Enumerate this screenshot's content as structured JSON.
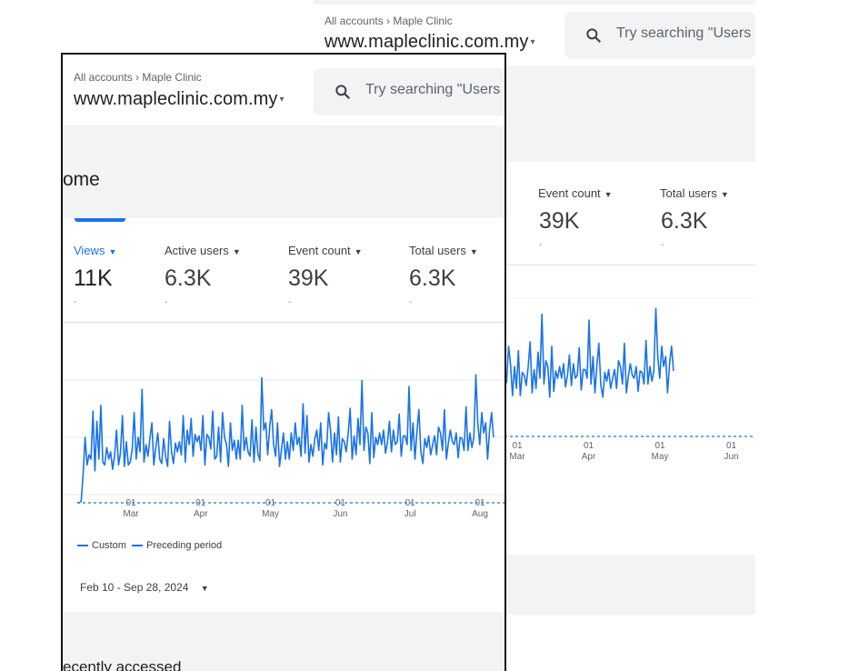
{
  "header": {
    "breadcrumb_root": "All accounts",
    "breadcrumb_sep": "›",
    "breadcrumb_account": "Maple Clinic",
    "property": "www.mapleclinic.com.my",
    "property_caret": "▾",
    "search_placeholder": "Try searching \"Users o"
  },
  "page_title": "ome",
  "metrics": [
    {
      "label": "Views",
      "value": "11K",
      "sub": "-",
      "caret": "▼"
    },
    {
      "label": "Active users",
      "value": "6.3K",
      "sub": "-",
      "caret": "▼"
    },
    {
      "label": "Event count",
      "value": "39K",
      "sub": "-",
      "caret": "▼"
    },
    {
      "label": "Total users",
      "value": "6.3K",
      "sub": "-",
      "caret": "▼"
    }
  ],
  "chart_data": {
    "type": "line",
    "x_ticks": [
      {
        "day": "01",
        "month": "Mar"
      },
      {
        "day": "01",
        "month": "Apr"
      },
      {
        "day": "01",
        "month": "May"
      },
      {
        "day": "01",
        "month": "Jun"
      },
      {
        "day": "01",
        "month": "Jul"
      },
      {
        "day": "01",
        "month": "Aug"
      }
    ],
    "series": [
      {
        "name": "Custom",
        "style": "solid",
        "color": "#1a73e8",
        "values": [
          0,
          0,
          1,
          20,
          45,
          26,
          33,
          30,
          63,
          22,
          56,
          30,
          67,
          28,
          26,
          38,
          30,
          35,
          23,
          32,
          50,
          26,
          34,
          60,
          25,
          42,
          26,
          28,
          37,
          62,
          30,
          45,
          35,
          78,
          28,
          40,
          32,
          44,
          55,
          26,
          38,
          48,
          30,
          27,
          44,
          32,
          25,
          56,
          35,
          27,
          41,
          35,
          42,
          33,
          60,
          28,
          50,
          40,
          58,
          32,
          47,
          42,
          46,
          36,
          60,
          26,
          47,
          45,
          37,
          63,
          30,
          32,
          52,
          28,
          62,
          45,
          40,
          25,
          55,
          36,
          43,
          30,
          43,
          30,
          67,
          36,
          45,
          35,
          32,
          57,
          28,
          52,
          34,
          29,
          86,
          50,
          55,
          33,
          52,
          64,
          40,
          32,
          55,
          25,
          36,
          48,
          30,
          42,
          30,
          48,
          36,
          55,
          40,
          45,
          32,
          68,
          34,
          60,
          28,
          40,
          32,
          44,
          50,
          36,
          55,
          26,
          41,
          37,
          62,
          50,
          28,
          48,
          33,
          59,
          28,
          44,
          42,
          35,
          48,
          65,
          30,
          46,
          33,
          58,
          40,
          84,
          36,
          52,
          48,
          27,
          62,
          31,
          45,
          40,
          48,
          40,
          50,
          34,
          42,
          56,
          35,
          50,
          40,
          42,
          61,
          32,
          46,
          46,
          40,
          80,
          36,
          55,
          30,
          49,
          64,
          35,
          27,
          44,
          38,
          46,
          33,
          40,
          46,
          33,
          52,
          48,
          36,
          64,
          30,
          41,
          50,
          42,
          40,
          48,
          31,
          45,
          44,
          36,
          66,
          36,
          48,
          38,
          45,
          88,
          55,
          40,
          62,
          48,
          55,
          30,
          50,
          62,
          45
        ]
      },
      {
        "name": "Preceding period",
        "style": "dashed",
        "color": "#1a73e8",
        "values": [
          0
        ]
      }
    ]
  },
  "legend": {
    "custom": "Custom",
    "preceding": "Preceding period"
  },
  "date_range": {
    "label": "Feb 10 - Sep 28, 2024",
    "caret": "▼"
  },
  "recent_section": "ecently accessed",
  "colors": {
    "accent": "#1a73e8",
    "text": "#202124",
    "muted": "#5f6368",
    "surface": "#f1f3f4"
  },
  "icons": {
    "search": "search-icon",
    "dropdown": "dropdown-caret-icon"
  }
}
